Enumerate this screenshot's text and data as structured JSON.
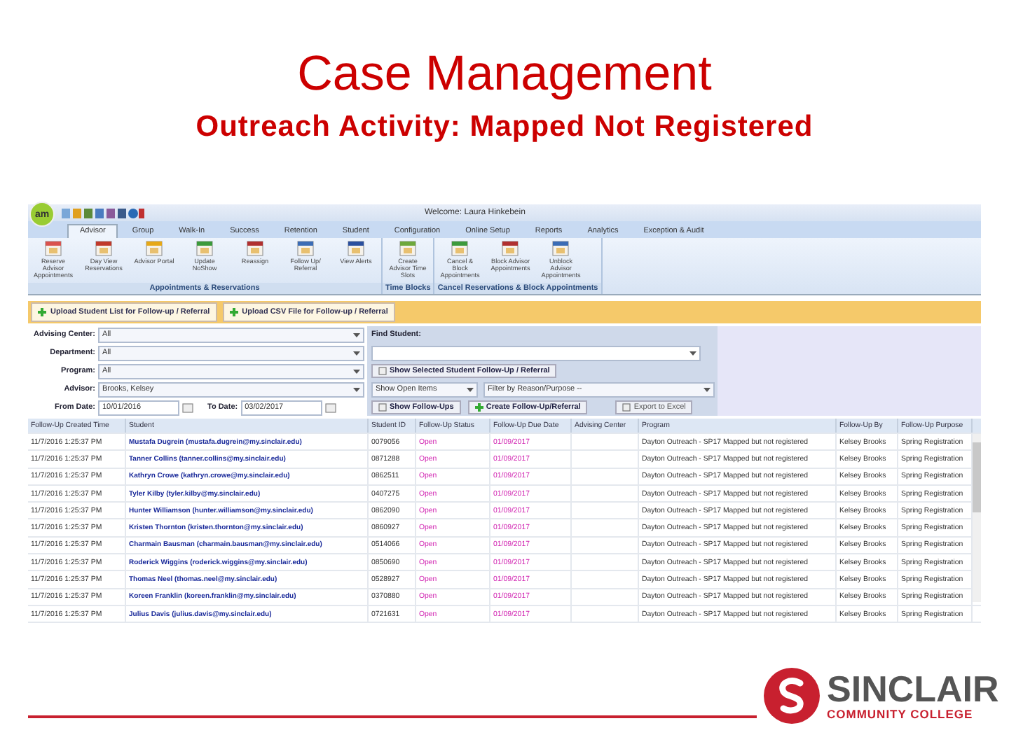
{
  "title": "Case Management",
  "subtitle": "Outreach Activity: Mapped Not Registered",
  "app": {
    "logo": "am",
    "welcome": "Welcome: Laura Hinkebein",
    "tabs": [
      {
        "label": "Advisor",
        "selected": true
      },
      {
        "label": "Group",
        "selected": false
      },
      {
        "label": "Walk-In",
        "selected": false
      },
      {
        "label": "Success",
        "selected": false
      },
      {
        "label": "Retention",
        "selected": false
      },
      {
        "label": "Student",
        "selected": false
      },
      {
        "label": "Configuration",
        "selected": false
      },
      {
        "label": "Online Setup",
        "selected": false
      },
      {
        "label": "Reports",
        "selected": false
      },
      {
        "label": "Analytics",
        "selected": false
      },
      {
        "label": "Exception & Audit",
        "selected": false
      }
    ],
    "ribbon_groups": [
      {
        "title": "Appointments & Reservations",
        "buttons": [
          "Reserve Advisor Appointments",
          "Day View Reservations",
          "Advisor Portal",
          "Update NoShow",
          "Reassign",
          "Follow Up/ Referral",
          "View Alerts"
        ]
      },
      {
        "title": "Time Blocks",
        "buttons": [
          "Create Advisor Time Slots"
        ]
      },
      {
        "title": "Cancel Reservations & Block Appointments",
        "buttons": [
          "Cancel & Block Appointments",
          "Block Advisor Appointments",
          "Unblock Advisor Appointments"
        ]
      }
    ],
    "upload_buttons": [
      "Upload Student List for Follow-up / Referral",
      "Upload CSV File for Follow-up / Referral"
    ],
    "filters": [
      {
        "label": "Advising Center:",
        "value": "All"
      },
      {
        "label": "Department:",
        "value": "All"
      },
      {
        "label": "Program:",
        "value": "All"
      },
      {
        "label": "Advisor:",
        "value": "Brooks, Kelsey"
      }
    ],
    "from_date": {
      "label": "From Date:",
      "value": "10/01/2016"
    },
    "to_date": {
      "label": "To Date:",
      "value": "03/02/2017"
    },
    "find_student": "Find Student:",
    "show_selected_button": "Show Selected Student Follow-Up / Referral",
    "item_filter": "Show Open Items",
    "reason_filter": "Filter by Reason/Purpose --",
    "action_buttons": [
      "Show Follow-Ups",
      "Create Follow-Up/Referral",
      "Export to Excel"
    ],
    "columns": [
      "Follow-Up Created Time",
      "Student",
      "Student ID",
      "Follow-Up Status",
      "Follow-Up Due Date",
      "Advising Center",
      "Program",
      "Follow-Up By",
      "Follow-Up Purpose"
    ],
    "rows": [
      [
        "11/7/2016 1:25:37 PM",
        "Mustafa Dugrein (mustafa.dugrein@my.sinclair.edu)",
        "0079056",
        "Open",
        "01/09/2017",
        "",
        "Dayton Outreach - SP17 Mapped but not registered",
        "Kelsey Brooks",
        "Spring Registration"
      ],
      [
        "11/7/2016 1:25:37 PM",
        "Tanner Collins (tanner.collins@my.sinclair.edu)",
        "0871288",
        "Open",
        "01/09/2017",
        "",
        "Dayton Outreach - SP17 Mapped but not registered",
        "Kelsey Brooks",
        "Spring Registration"
      ],
      [
        "11/7/2016 1:25:37 PM",
        "Kathryn Crowe (kathryn.crowe@my.sinclair.edu)",
        "0862511",
        "Open",
        "01/09/2017",
        "",
        "Dayton Outreach - SP17 Mapped but not registered",
        "Kelsey Brooks",
        "Spring Registration"
      ],
      [
        "11/7/2016 1:25:37 PM",
        "Tyler Kilby (tyler.kilby@my.sinclair.edu)",
        "0407275",
        "Open",
        "01/09/2017",
        "",
        "Dayton Outreach - SP17 Mapped but not registered",
        "Kelsey Brooks",
        "Spring Registration"
      ],
      [
        "11/7/2016 1:25:37 PM",
        "Hunter Williamson (hunter.williamson@my.sinclair.edu)",
        "0862090",
        "Open",
        "01/09/2017",
        "",
        "Dayton Outreach - SP17 Mapped but not registered",
        "Kelsey Brooks",
        "Spring Registration"
      ],
      [
        "11/7/2016 1:25:37 PM",
        "Kristen Thornton (kristen.thornton@my.sinclair.edu)",
        "0860927",
        "Open",
        "01/09/2017",
        "",
        "Dayton Outreach - SP17 Mapped but not registered",
        "Kelsey Brooks",
        "Spring Registration"
      ],
      [
        "11/7/2016 1:25:37 PM",
        "Charmain Bausman (charmain.bausman@my.sinclair.edu)",
        "0514066",
        "Open",
        "01/09/2017",
        "",
        "Dayton Outreach - SP17 Mapped but not registered",
        "Kelsey Brooks",
        "Spring Registration"
      ],
      [
        "11/7/2016 1:25:37 PM",
        "Roderick Wiggins (roderick.wiggins@my.sinclair.edu)",
        "0850690",
        "Open",
        "01/09/2017",
        "",
        "Dayton Outreach - SP17 Mapped but not registered",
        "Kelsey Brooks",
        "Spring Registration"
      ],
      [
        "11/7/2016 1:25:37 PM",
        "Thomas Neel (thomas.neel@my.sinclair.edu)",
        "0528927",
        "Open",
        "01/09/2017",
        "",
        "Dayton Outreach - SP17 Mapped but not registered",
        "Kelsey Brooks",
        "Spring Registration"
      ],
      [
        "11/7/2016 1:25:37 PM",
        "Koreen Franklin (koreen.franklin@my.sinclair.edu)",
        "0370880",
        "Open",
        "01/09/2017",
        "",
        "Dayton Outreach - SP17 Mapped but not registered",
        "Kelsey Brooks",
        "Spring Registration"
      ],
      [
        "11/7/2016 1:25:37 PM",
        "Julius Davis (julius.davis@my.sinclair.edu)",
        "0721631",
        "Open",
        "01/09/2017",
        "",
        "Dayton Outreach - SP17 Mapped but not registered",
        "Kelsey Brooks",
        "Spring Registration"
      ]
    ]
  },
  "footer_logo": {
    "name": "SINCLAIR",
    "tagline": "COMMUNITY COLLEGE"
  }
}
